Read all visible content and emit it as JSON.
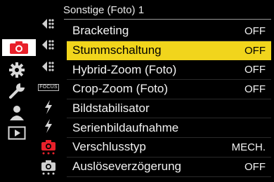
{
  "page": {
    "title": "Sonstige (Foto) 1"
  },
  "main_tabs": [
    {
      "name": "camera-icon",
      "active": true
    },
    {
      "name": "gear-icon",
      "active": false
    },
    {
      "name": "wrench-icon",
      "active": false
    },
    {
      "name": "person-icon",
      "active": false
    },
    {
      "name": "playback-icon",
      "active": false
    }
  ],
  "sub_tabs": [
    {
      "name": "af-mode-icon",
      "label": ""
    },
    {
      "name": "af-mode-icon",
      "label": ""
    },
    {
      "name": "af-mode-icon",
      "label": ""
    },
    {
      "name": "focus-icon",
      "label": "FOCUS"
    },
    {
      "name": "flash-icon",
      "label": ""
    },
    {
      "name": "flash-icon",
      "label": ""
    },
    {
      "name": "camera-other-active-icon",
      "label": ""
    },
    {
      "name": "camera-other-icon",
      "label": ""
    }
  ],
  "menu": {
    "items": [
      {
        "label": "Bracketing",
        "value": "OFF",
        "selected": false
      },
      {
        "label": "Stummschaltung",
        "value": "OFF",
        "selected": true
      },
      {
        "label": "Hybrid-Zoom (Foto)",
        "value": "OFF",
        "selected": false
      },
      {
        "label": "Crop-Zoom (Foto)",
        "value": "OFF",
        "selected": false
      },
      {
        "label": "Bildstabilisator",
        "value": "",
        "selected": false
      },
      {
        "label": "Serienbildaufnahme",
        "value": "",
        "selected": false
      },
      {
        "label": "Verschlusstyp",
        "value": "MECH.",
        "selected": false
      },
      {
        "label": "Auslöseverzögerung",
        "value": "OFF",
        "selected": false
      }
    ]
  },
  "colors": {
    "accent_red": "#e8202a",
    "selection_yellow": "#f1d51c",
    "icon_grey": "#d9d9d9"
  }
}
